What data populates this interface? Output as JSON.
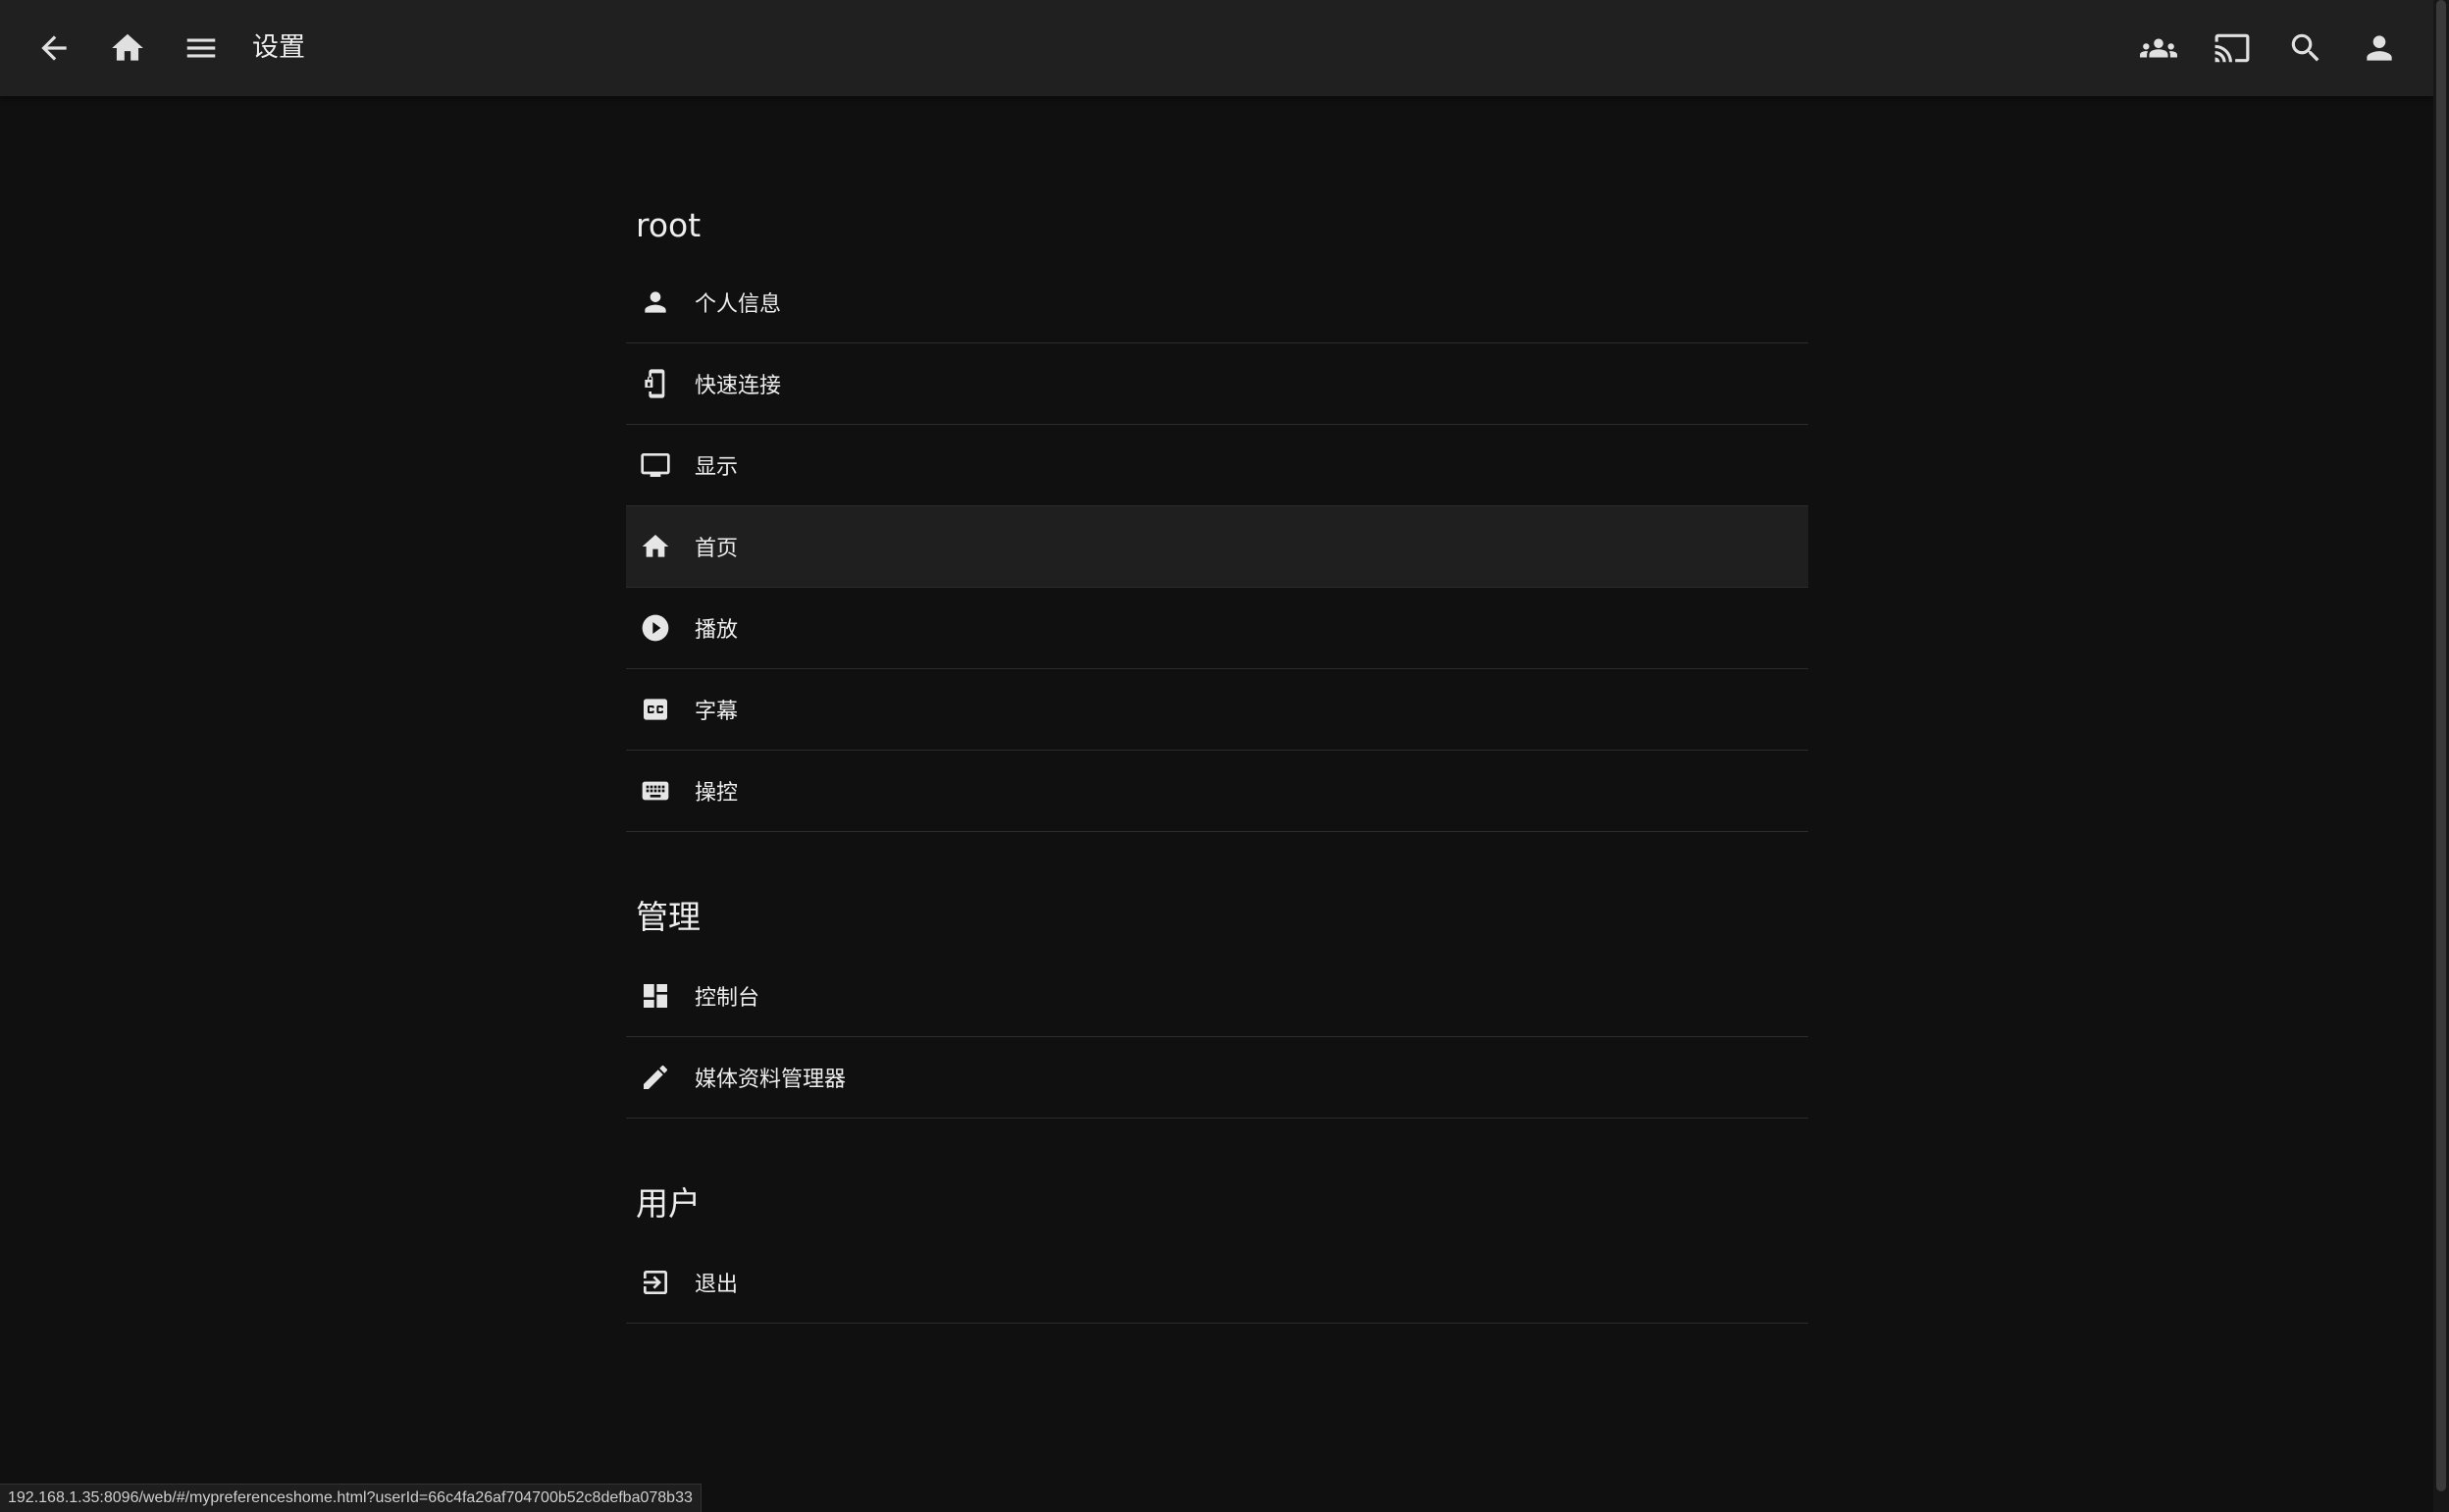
{
  "header": {
    "title": "设置",
    "left_icons": [
      "back-arrow-icon",
      "home-icon",
      "menu-icon"
    ],
    "right_icons": [
      "group-icon",
      "cast-icon",
      "search-icon",
      "account-icon"
    ]
  },
  "sections": [
    {
      "title": "root",
      "items": [
        {
          "label": "个人信息",
          "icon": "person-icon"
        },
        {
          "label": "快速连接",
          "icon": "phone-link-icon"
        },
        {
          "label": "显示",
          "icon": "monitor-icon"
        },
        {
          "label": "首页",
          "icon": "home-icon"
        },
        {
          "label": "播放",
          "icon": "play-circle-icon"
        },
        {
          "label": "字幕",
          "icon": "closed-caption-icon"
        },
        {
          "label": "操控",
          "icon": "keyboard-icon"
        }
      ]
    },
    {
      "title": "管理",
      "items": [
        {
          "label": "控制台",
          "icon": "dashboard-icon"
        },
        {
          "label": "媒体资料管理器",
          "icon": "pencil-icon"
        }
      ]
    },
    {
      "title": "用户",
      "items": [
        {
          "label": "退出",
          "icon": "logout-icon"
        }
      ]
    }
  ],
  "status_url": "192.168.1.35:8096/web/#/mypreferenceshome.html?userId=66c4fa26af704700b52c8defba078b33",
  "colors": {
    "background": "#101010",
    "header": "#202020",
    "text": "#eeeeee",
    "divider": "#2c2c2c"
  }
}
